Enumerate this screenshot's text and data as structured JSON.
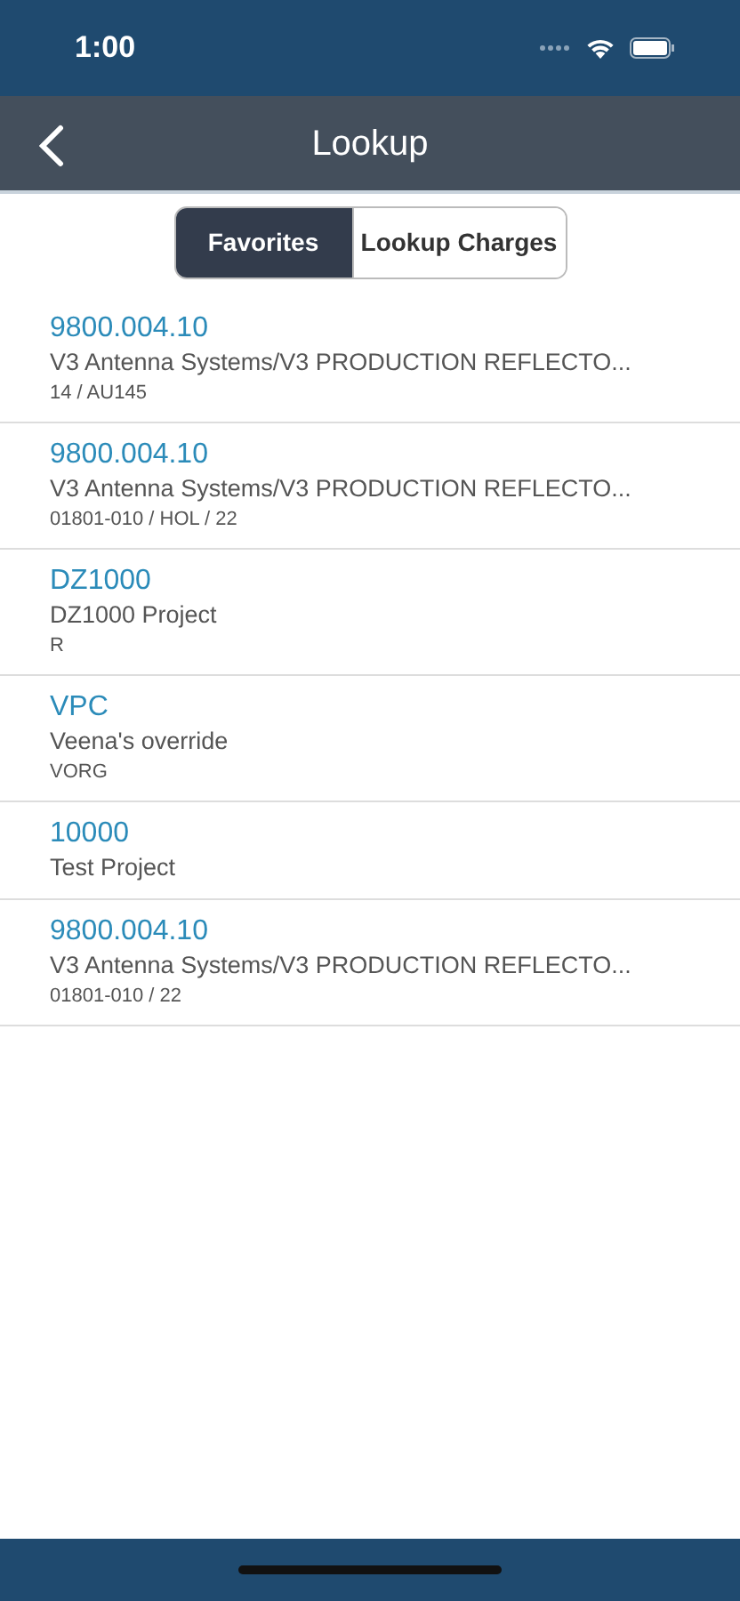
{
  "status_bar": {
    "time": "1:00"
  },
  "nav_bar": {
    "title": "Lookup"
  },
  "segments": [
    {
      "label": "Favorites",
      "selected": true
    },
    {
      "label": "Lookup Charges",
      "selected": false
    }
  ],
  "items": [
    {
      "code": "9800.004.10",
      "name": "V3 Antenna Systems/V3 PRODUCTION REFLECTO...",
      "detail": "14 / AU145"
    },
    {
      "code": "9800.004.10",
      "name": "V3 Antenna Systems/V3 PRODUCTION REFLECTO...",
      "detail": "01801-010 / HOL / 22"
    },
    {
      "code": "DZ1000",
      "name": "DZ1000 Project",
      "detail": "R"
    },
    {
      "code": "VPC",
      "name": "Veena's override",
      "detail": "VORG"
    },
    {
      "code": "10000",
      "name": "Test Project"
    },
    {
      "code": "9800.004.10",
      "name": "V3 Antenna Systems/V3 PRODUCTION REFLECTO...",
      "detail": "01801-010 / 22"
    }
  ]
}
